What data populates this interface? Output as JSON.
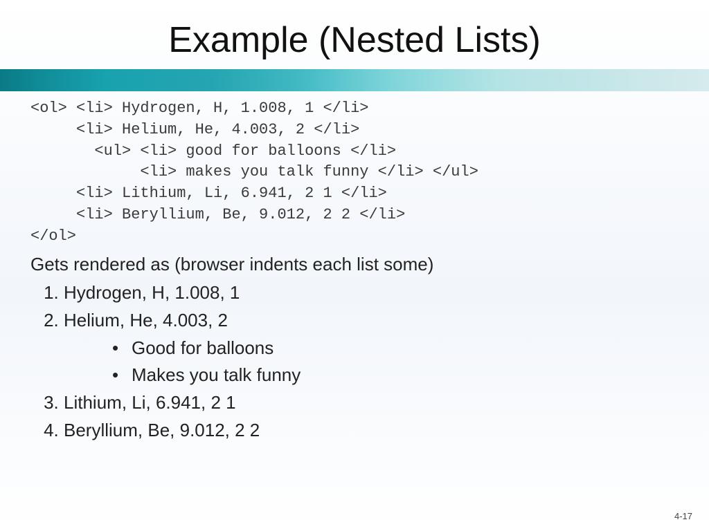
{
  "title": "Example (Nested Lists)",
  "code": {
    "l1": "<ol> <li> Hydrogen, H, 1.008, 1 </li>",
    "l2": "     <li> Helium, He, 4.003, 2 </li>",
    "l3": "       <ul> <li> good for balloons </li>",
    "l4": "            <li> makes you talk funny </li> </ul>",
    "l5": "     <li> Lithium, Li, 6.941, 2 1 </li>",
    "l6": "     <li> Beryllium, Be, 9.012, 2 2 </li>",
    "l7": "</ol>"
  },
  "explain": "Gets rendered as (browser indents each list some)",
  "rendered": {
    "i1": "Hydrogen, H, 1.008, 1",
    "i2": "Helium, He, 4.003, 2",
    "i2a": "Good for balloons",
    "i2b": "Makes you talk funny",
    "i3": "Lithium, Li, 6.941, 2 1",
    "i4": "Beryllium, Be, 9.012, 2 2"
  },
  "pagenum": "4-17"
}
